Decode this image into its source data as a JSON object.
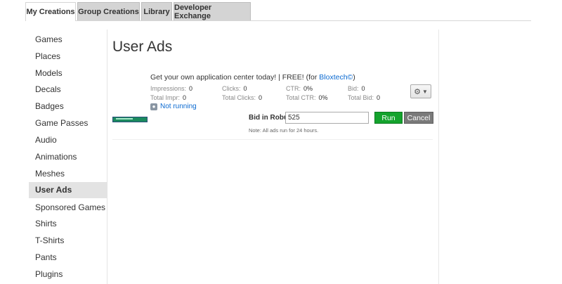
{
  "tabs": [
    {
      "label": "My Creations",
      "active": true
    },
    {
      "label": "Group Creations"
    },
    {
      "label": "Library"
    },
    {
      "label": "Developer Exchange"
    }
  ],
  "sidebar": {
    "items": [
      {
        "label": "Games"
      },
      {
        "label": "Places"
      },
      {
        "label": "Models"
      },
      {
        "label": "Decals"
      },
      {
        "label": "Badges"
      },
      {
        "label": "Game Passes"
      },
      {
        "label": "Audio"
      },
      {
        "label": "Animations"
      },
      {
        "label": "Meshes"
      },
      {
        "label": "User Ads",
        "active": true
      },
      {
        "label": "Sponsored Games"
      },
      {
        "label": "Shirts"
      },
      {
        "label": "T-Shirts"
      },
      {
        "label": "Pants"
      },
      {
        "label": "Plugins"
      }
    ]
  },
  "main": {
    "title": "User Ads",
    "ad": {
      "title_prefix": "Get your own application center today! | FREE! (for ",
      "title_link": "Bloxtech©",
      "title_suffix": ")",
      "stats": {
        "impressions_label": "Impressions:",
        "impressions_value": "0",
        "clicks_label": "Clicks:",
        "clicks_value": "0",
        "ctr_label": "CTR:",
        "ctr_value": "0%",
        "bid_label": "Bid:",
        "bid_value": "0",
        "total_impr_label": "Total Impr:",
        "total_impr_value": "0",
        "total_clicks_label": "Total Clicks:",
        "total_clicks_value": "0",
        "total_ctr_label": "Total CTR:",
        "total_ctr_value": "0%",
        "total_bid_label": "Total Bid:",
        "total_bid_value": "0"
      },
      "status": "Not running",
      "gear_icon": "gear-icon",
      "bid_in_robux_label": "Bid in Robux:",
      "bid_value": "525",
      "run_label": "Run",
      "cancel_label": "Cancel",
      "note": "Note: All ads run for 24 hours."
    }
  },
  "colors": {
    "link": "#0b6ad1",
    "run": "#14a32d",
    "cancel": "#7a7a7a",
    "active_sidebar": "#e3e3e3"
  }
}
